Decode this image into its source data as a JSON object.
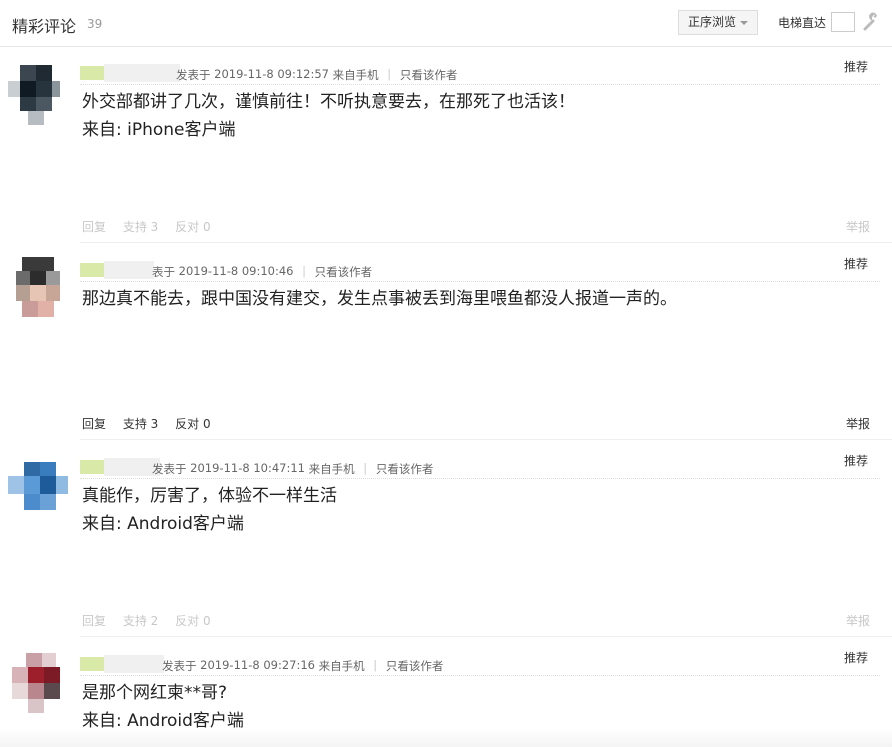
{
  "header": {
    "title": "精彩评论",
    "count": "39",
    "sort_label": "正序浏览",
    "elevator_label": "电梯直达"
  },
  "posts": [
    {
      "meta_prefix": "发表于",
      "time": "2019-11-8 09:12:57",
      "device": "来自手机",
      "author_only": "只看该作者",
      "recommend": "推荐",
      "lines": [
        "外交部都讲了几次，谨慎前往！不听执意要去，在那死了也活该！",
        "来自: iPhone客户端"
      ],
      "reply": "回复",
      "support": "支持 3",
      "oppose": "反对 0",
      "report": "举报"
    },
    {
      "meta_prefix": "表于",
      "time": "2019-11-8 09:10:46",
      "device": "",
      "author_only": "只看该作者",
      "recommend": "推荐",
      "lines": [
        "那边真不能去，跟中国没有建交，发生点事被丢到海里喂鱼都没人报道一声的。",
        ""
      ],
      "reply": "回复",
      "support": "支持 3",
      "oppose": "反对 0",
      "report": "举报"
    },
    {
      "meta_prefix": "发表于",
      "time": "2019-11-8 10:47:11",
      "device": "来自手机",
      "author_only": "只看该作者",
      "recommend": "推荐",
      "lines": [
        "真能作，厉害了，体验不一样生活",
        "来自: Android客户端"
      ],
      "reply": "回复",
      "support": "支持 2",
      "oppose": "反对 0",
      "report": "举报"
    },
    {
      "meta_prefix": "发表于",
      "time": "2019-11-8 09:27:16",
      "device": "来自手机",
      "author_only": "只看该作者",
      "recommend": "推荐",
      "lines": [
        "是那个网红柬**哥?",
        "来自: Android客户端"
      ]
    }
  ]
}
